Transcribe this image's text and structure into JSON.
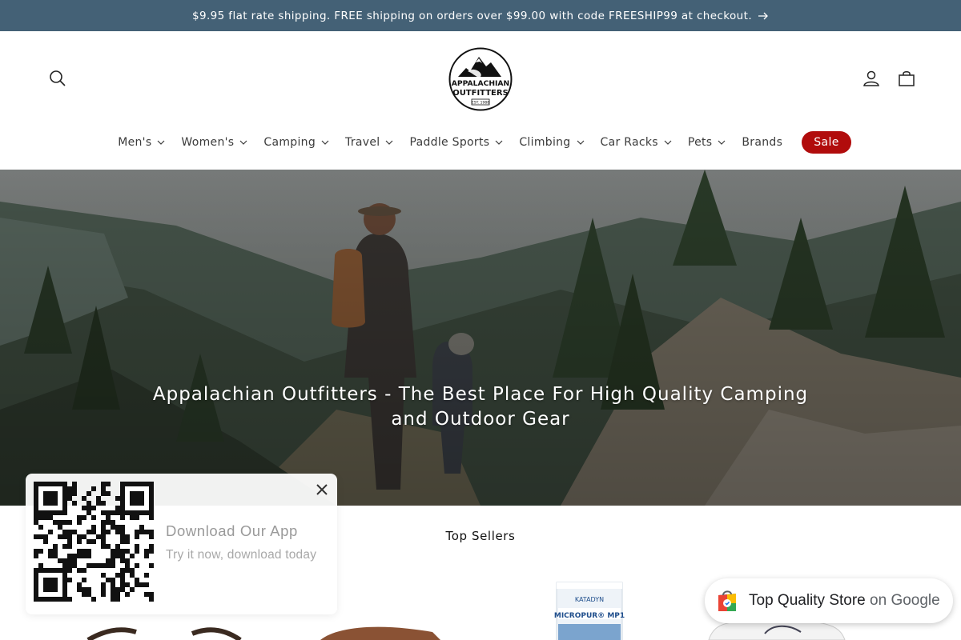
{
  "announcement": {
    "text": "$9.95 flat rate shipping. FREE shipping on orders over $99.00 with code FREESHIP99 at checkout.",
    "icon": "arrow-right-icon",
    "background": "#446176"
  },
  "header": {
    "logo": {
      "line1": "APPALACHIAN",
      "line2": "OUTFITTERS",
      "est": "EST. 1988"
    },
    "icons": [
      "search-icon",
      "account-icon",
      "cart-icon"
    ]
  },
  "nav": {
    "items": [
      {
        "label": "Men's",
        "dropdown": true
      },
      {
        "label": "Women's",
        "dropdown": true
      },
      {
        "label": "Camping",
        "dropdown": true
      },
      {
        "label": "Travel",
        "dropdown": true
      },
      {
        "label": "Paddle Sports",
        "dropdown": true
      },
      {
        "label": "Climbing",
        "dropdown": true
      },
      {
        "label": "Car Racks",
        "dropdown": true
      },
      {
        "label": "Pets",
        "dropdown": true
      },
      {
        "label": "Brands",
        "dropdown": false
      }
    ],
    "sale_label": "Sale",
    "sale_color": "#b10c0c"
  },
  "hero": {
    "title": "Appalachian Outfitters - The Best Place For High Quality Camping and Outdoor Gear"
  },
  "top_sellers": {
    "title": "Top Sellers",
    "products": [
      {
        "name": "",
        "image_text": ""
      },
      {
        "name": "",
        "image_text": ""
      },
      {
        "name": "",
        "image_text": "KATADYN MICROPUR MP1"
      },
      {
        "name": "",
        "image_text": ""
      }
    ],
    "product3_brand": "KATADYN",
    "product3_line": "MICROPUR® MP1"
  },
  "app_popup": {
    "title": "Download Our App",
    "subtitle": "Try it now, download today"
  },
  "google_badge": {
    "label": "Top Quality Store",
    "suffix": "on Google"
  }
}
